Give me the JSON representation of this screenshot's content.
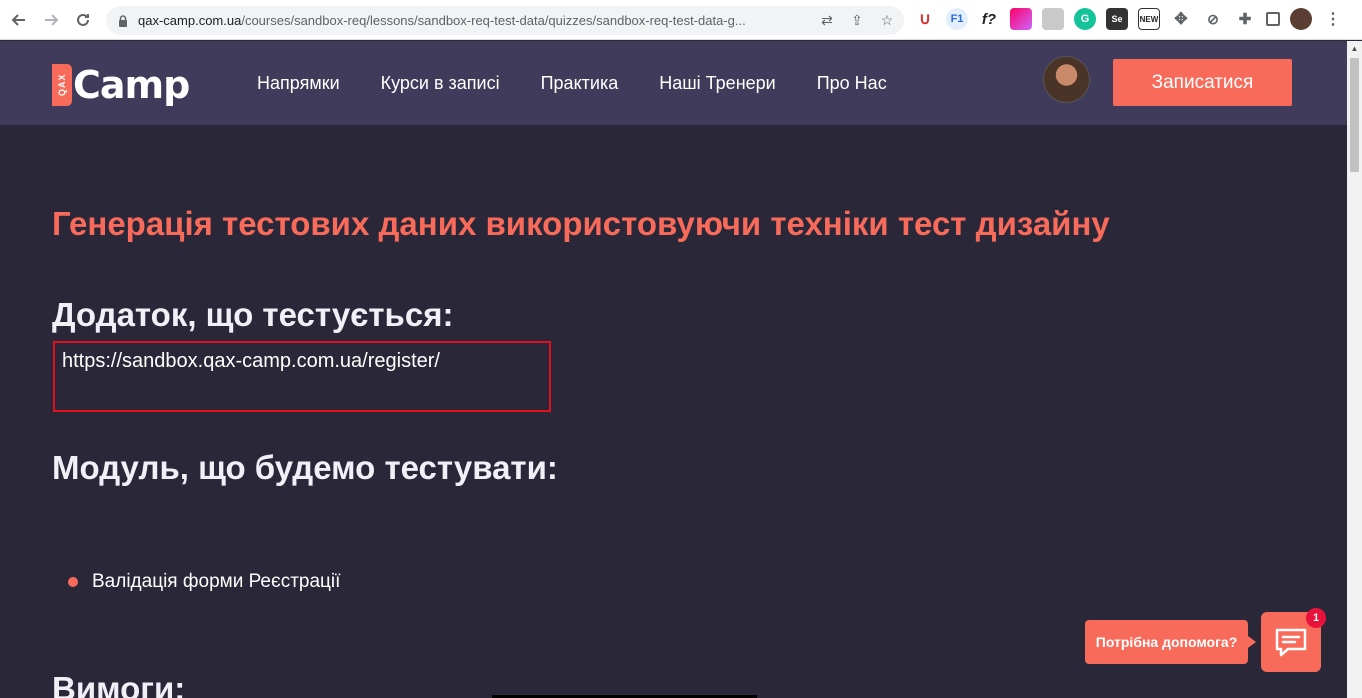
{
  "browser": {
    "url_host": "qax-camp.com.ua",
    "url_path": "/courses/sandbox-req/lessons/sandbox-req-test-data/quizzes/sandbox-req-test-data-g...",
    "extensions": [
      "magnet-icon",
      "f1-icon",
      "f-question-icon",
      "gradient-icon",
      "puzzle-grid-icon",
      "grammarly-icon",
      "selenium-icon",
      "new-icon",
      "move-icon",
      "compass-icon",
      "extensions-icon",
      "sidebar-icon",
      "profile-icon",
      "menu-icon"
    ]
  },
  "header": {
    "logo_badge": "QAX",
    "logo_text": "Camp",
    "nav": [
      "Напрямки",
      "Курси в записі",
      "Практика",
      "Наші Тренери",
      "Про Нас"
    ],
    "signup_label": "Записатися"
  },
  "main": {
    "title": "Генерація тестових даних використовуючи техніки тест дизайну",
    "app_heading": "Додаток, що тестується:",
    "app_url": "https://sandbox.qax-camp.com.ua/register/",
    "module_heading": "Модуль, що будемо тестувати:",
    "module_items": [
      "Валідація форми Реєстрації"
    ],
    "requirements_heading": "Вимоги:"
  },
  "help": {
    "bubble_text": "Потрібна допомога?",
    "badge_count": "1"
  },
  "colors": {
    "accent": "#f86b5a",
    "header_bg": "#403b5a",
    "page_bg": "#2a2738",
    "highlight_border": "#e0101c"
  }
}
